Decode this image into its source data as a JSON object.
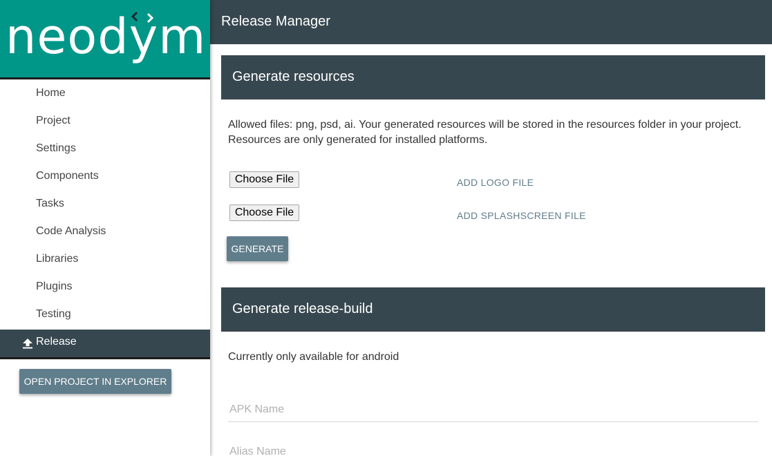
{
  "sidebar": {
    "logo_text": "neodym",
    "items": [
      {
        "label": "Home"
      },
      {
        "label": "Project"
      },
      {
        "label": "Settings"
      },
      {
        "label": "Components"
      },
      {
        "label": "Tasks"
      },
      {
        "label": "Code Analysis"
      },
      {
        "label": "Libraries"
      },
      {
        "label": "Plugins"
      },
      {
        "label": "Testing"
      },
      {
        "label": "Release",
        "active": true,
        "icon": "upload-icon"
      }
    ],
    "explorer_button": "OPEN PROJECT IN EXPLORER"
  },
  "header": {
    "title": "Release Manager"
  },
  "resources": {
    "title": "Generate resources",
    "description_line1": "Allowed files: png, psd, ai. Your generated resources will be stored in the resources folder in your project.",
    "description_line2": "Resources are only generated for installed platforms.",
    "logo_button": "Choose File",
    "logo_label": "ADD LOGO FILE",
    "splash_button": "Choose File",
    "splash_label": "ADD SPLASHSCREEN FILE",
    "generate_button": "GENERATE"
  },
  "release_build": {
    "title": "Generate release-build",
    "note": "Currently only available for android",
    "apk_placeholder": "APK Name",
    "alias_placeholder": "Alias Name"
  },
  "colors": {
    "brand_teal": "#009688",
    "header_dark": "#37474f",
    "button_grey": "#607d8b"
  }
}
